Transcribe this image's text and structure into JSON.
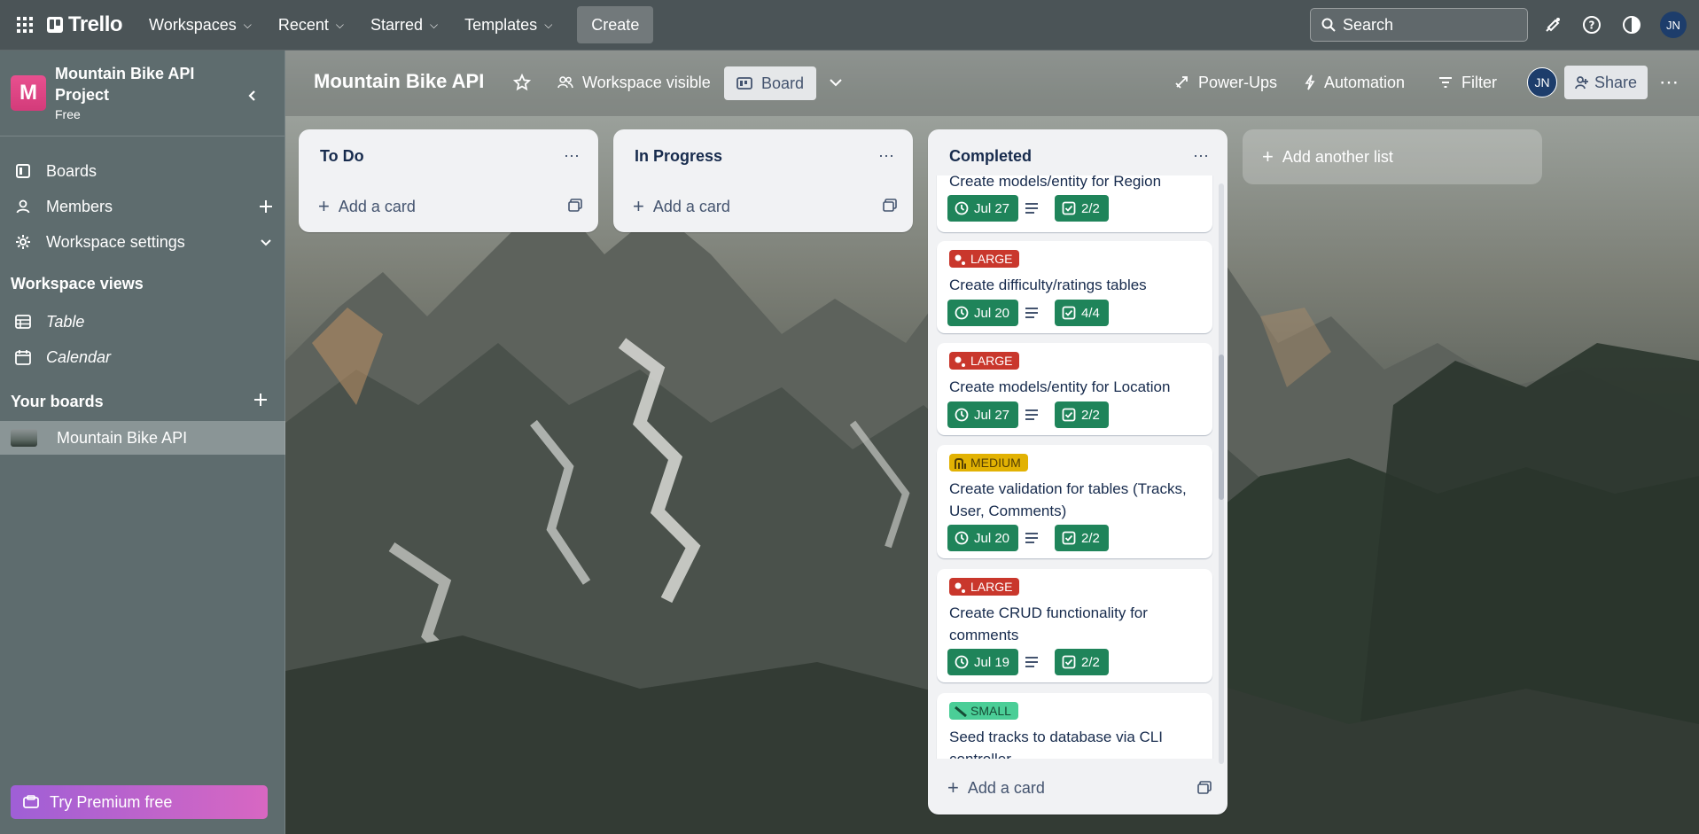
{
  "topbar": {
    "app_name": "Trello",
    "nav": [
      "Workspaces",
      "Recent",
      "Starred",
      "Templates"
    ],
    "create_label": "Create",
    "search_placeholder": "Search",
    "user_initials": "JN",
    "icons": [
      "apps-grid-icon",
      "bell-icon",
      "help-icon",
      "theme-icon"
    ]
  },
  "sidebar": {
    "workspace_initial": "M",
    "workspace_name": "Mountain Bike API Project",
    "workspace_plan": "Free",
    "items": [
      {
        "label": "Boards"
      },
      {
        "label": "Members"
      },
      {
        "label": "Workspace settings"
      }
    ],
    "views_heading": "Workspace views",
    "views": [
      {
        "label": "Table"
      },
      {
        "label": "Calendar"
      }
    ],
    "boards_heading": "Your boards",
    "boards": [
      {
        "label": "Mountain Bike API"
      }
    ],
    "premium_label": "Try Premium free"
  },
  "board": {
    "title": "Mountain Bike API",
    "visibility": "Workspace visible",
    "view_label": "Board",
    "powerups": "Power-Ups",
    "automation": "Automation",
    "filter": "Filter",
    "member_initials": "JN",
    "share": "Share",
    "add_list": "Add another list"
  },
  "lists": [
    {
      "title": "To Do",
      "add_card": "Add a card"
    },
    {
      "title": "In Progress",
      "add_card": "Add a card"
    },
    {
      "title": "Completed",
      "add_card": "Add a card"
    }
  ],
  "completed_cards": [
    {
      "label": "",
      "title": "Create models/entity for Region",
      "due": "Jul 27",
      "checklist": "2/2"
    },
    {
      "label": "LARGE",
      "label_color": "#c9372c",
      "title": "Create difficulty/ratings tables",
      "due": "Jul 20",
      "checklist": "4/4"
    },
    {
      "label": "LARGE",
      "label_color": "#c9372c",
      "title": "Create models/entity for Location",
      "due": "Jul 27",
      "checklist": "2/2"
    },
    {
      "label": "MEDIUM",
      "label_color": "#e2b203",
      "title": "Create validation for tables (Tracks, User, Comments)",
      "due": "Jul 20",
      "checklist": "2/2"
    },
    {
      "label": "LARGE",
      "label_color": "#c9372c",
      "title": "Create CRUD functionality for comments",
      "due": "Jul 19",
      "checklist": "2/2"
    },
    {
      "label": "SMALL",
      "label_color": "#4bce97",
      "title": "Seed tracks to database via CLI controller",
      "due": "",
      "checklist": ""
    }
  ]
}
